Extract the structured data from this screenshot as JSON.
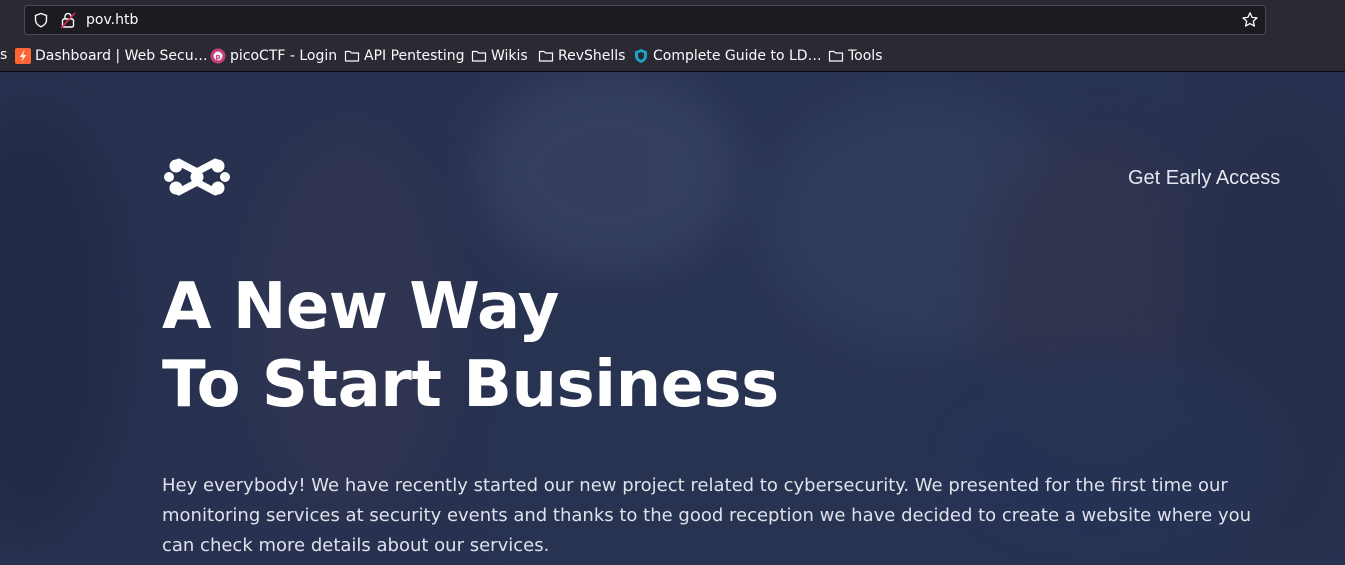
{
  "browser": {
    "url": "pov.htb",
    "icons": {
      "tracking": "shield-icon",
      "security": "insecure-lock-icon",
      "bookmark_star": "star-icon"
    },
    "bookmarks": [
      {
        "label": "Dashboard | Web Secu…",
        "icon": "burp-favicon"
      },
      {
        "label": "picoCTF - Login",
        "icon": "picoctf-favicon"
      },
      {
        "label": "API Pentesting",
        "icon": "folder-icon"
      },
      {
        "label": "Wikis",
        "icon": "folder-icon"
      },
      {
        "label": "RevShells",
        "icon": "folder-icon"
      },
      {
        "label": "Complete Guide to LD…",
        "icon": "shield-favicon"
      },
      {
        "label": "Tools",
        "icon": "folder-icon"
      }
    ]
  },
  "page": {
    "logo": "pov-logo-icon",
    "nav": {
      "early_access": "Get Early Access"
    },
    "hero": {
      "line1": "A New Way",
      "line2": "To Start Business"
    },
    "lead": "Hey everybody! We have recently started our new project related to cybersecurity. We presented for the first time our monitoring services at security events and thanks to the good reception we have decided to create a website where you can check more details about our services.",
    "colors": {
      "overlay": "#262f4e",
      "text": "#ffffff",
      "chrome": "#2b2a33"
    }
  }
}
